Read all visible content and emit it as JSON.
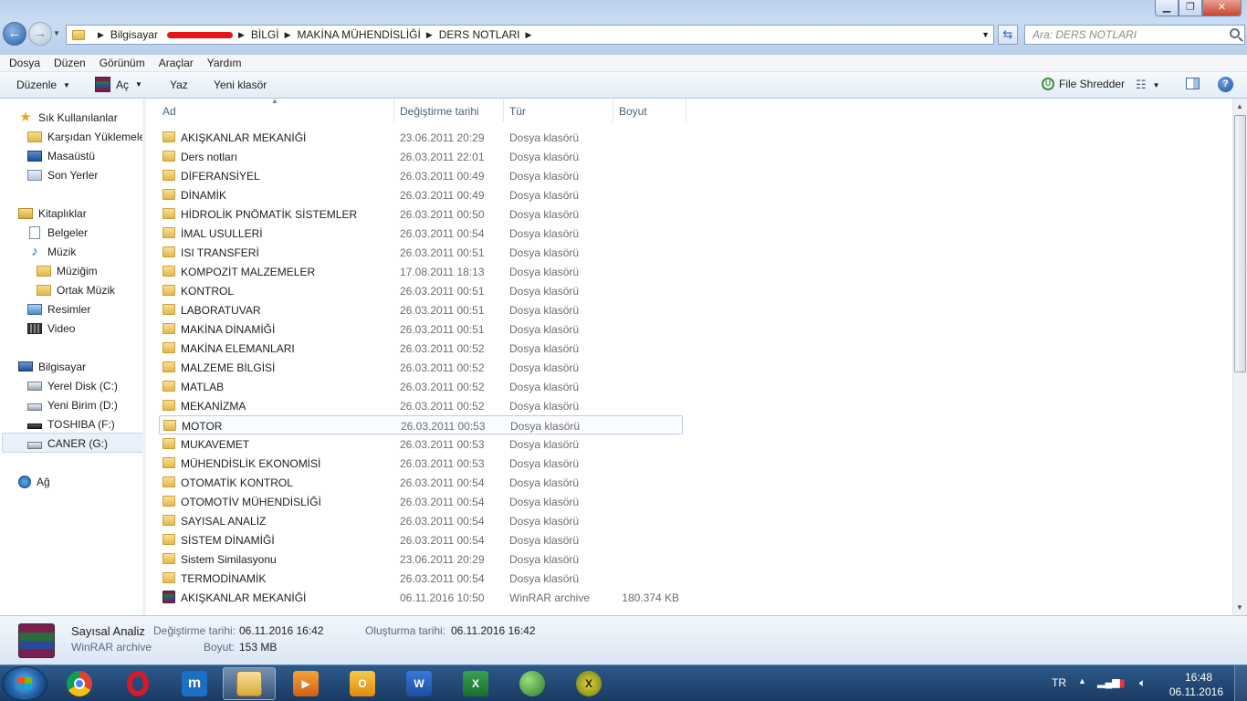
{
  "window": {
    "min_icon": "minimize-icon",
    "max_icon": "maximize-icon",
    "close_icon": "close-icon"
  },
  "address": {
    "crumbs": [
      "Bilgisayar",
      "BİLGİ",
      "MAKİNA MÜHENDİSLİĞİ",
      "DERS NOTLARI"
    ],
    "search_placeholder": "Ara: DERS NOTLARI"
  },
  "menu": [
    "Dosya",
    "Düzen",
    "Görünüm",
    "Araçlar",
    "Yardım"
  ],
  "toolbar": {
    "organize": "Düzenle",
    "open": "Aç",
    "write": "Yaz",
    "new_folder": "Yeni klasör",
    "shredder": "File Shredder"
  },
  "nav": {
    "favorites": "Sık Kullanılanlar",
    "downloads": "Karşıdan Yüklemeler",
    "desktop": "Masaüstü",
    "recent": "Son Yerler",
    "libraries": "Kitaplıklar",
    "documents": "Belgeler",
    "music": "Müzik",
    "my_music": "Müziğim",
    "public_music": "Ortak Müzik",
    "pictures": "Resimler",
    "video": "Video",
    "computer": "Bilgisayar",
    "disk_c": "Yerel Disk (C:)",
    "disk_d": "Yeni Birim (D:)",
    "disk_f": "TOSHIBA (F:)",
    "disk_g": "CANER (G:)",
    "network": "Ağ"
  },
  "columns": {
    "name": "Ad",
    "modified": "Değiştirme tarihi",
    "type": "Tür",
    "size": "Boyut"
  },
  "files": [
    {
      "name": "AKIŞKANLAR MEKANİĞİ",
      "date": "23.06.2011 20:29",
      "type": "Dosya klasörü",
      "size": "",
      "kind": "folder"
    },
    {
      "name": "Ders notları",
      "date": "26.03.2011 22:01",
      "type": "Dosya klasörü",
      "size": "",
      "kind": "folder"
    },
    {
      "name": "DİFERANSİYEL",
      "date": "26.03.2011 00:49",
      "type": "Dosya klasörü",
      "size": "",
      "kind": "folder"
    },
    {
      "name": "DİNAMİK",
      "date": "26.03.2011 00:49",
      "type": "Dosya klasörü",
      "size": "",
      "kind": "folder"
    },
    {
      "name": "HİDROLİK PNÖMATİK SİSTEMLER",
      "date": "26.03.2011 00:50",
      "type": "Dosya klasörü",
      "size": "",
      "kind": "folder"
    },
    {
      "name": "İMAL USULLERİ",
      "date": "26.03.2011 00:54",
      "type": "Dosya klasörü",
      "size": "",
      "kind": "folder"
    },
    {
      "name": "ISI TRANSFERİ",
      "date": "26.03.2011 00:51",
      "type": "Dosya klasörü",
      "size": "",
      "kind": "folder"
    },
    {
      "name": "KOMPOZİT MALZEMELER",
      "date": "17.08.2011 18:13",
      "type": "Dosya klasörü",
      "size": "",
      "kind": "folder"
    },
    {
      "name": "KONTROL",
      "date": "26.03.2011 00:51",
      "type": "Dosya klasörü",
      "size": "",
      "kind": "folder"
    },
    {
      "name": "LABORATUVAR",
      "date": "26.03.2011 00:51",
      "type": "Dosya klasörü",
      "size": "",
      "kind": "folder"
    },
    {
      "name": "MAKİNA DİNAMİĞİ",
      "date": "26.03.2011 00:51",
      "type": "Dosya klasörü",
      "size": "",
      "kind": "folder"
    },
    {
      "name": "MAKİNA ELEMANLARI",
      "date": "26.03.2011 00:52",
      "type": "Dosya klasörü",
      "size": "",
      "kind": "folder"
    },
    {
      "name": "MALZEME BİLGİSİ",
      "date": "26.03.2011 00:52",
      "type": "Dosya klasörü",
      "size": "",
      "kind": "folder"
    },
    {
      "name": "MATLAB",
      "date": "26.03.2011 00:52",
      "type": "Dosya klasörü",
      "size": "",
      "kind": "folder"
    },
    {
      "name": "MEKANİZMA",
      "date": "26.03.2011 00:52",
      "type": "Dosya klasörü",
      "size": "",
      "kind": "folder"
    },
    {
      "name": "MOTOR",
      "date": "26.03.2011 00:53",
      "type": "Dosya klasörü",
      "size": "",
      "kind": "folder"
    },
    {
      "name": "MUKAVEMET",
      "date": "26.03.2011 00:53",
      "type": "Dosya klasörü",
      "size": "",
      "kind": "folder"
    },
    {
      "name": "MÜHENDİSLİK EKONOMİSİ",
      "date": "26.03.2011 00:53",
      "type": "Dosya klasörü",
      "size": "",
      "kind": "folder"
    },
    {
      "name": "OTOMATİK KONTROL",
      "date": "26.03.2011 00:54",
      "type": "Dosya klasörü",
      "size": "",
      "kind": "folder"
    },
    {
      "name": "OTOMOTİV MÜHENDİSLİĞİ",
      "date": "26.03.2011 00:54",
      "type": "Dosya klasörü",
      "size": "",
      "kind": "folder"
    },
    {
      "name": "SAYISAL ANALİZ",
      "date": "26.03.2011 00:54",
      "type": "Dosya klasörü",
      "size": "",
      "kind": "folder"
    },
    {
      "name": "SİSTEM DİNAMİĞİ",
      "date": "26.03.2011 00:54",
      "type": "Dosya klasörü",
      "size": "",
      "kind": "folder"
    },
    {
      "name": "Sistem Similasyonu",
      "date": "23.06.2011 20:29",
      "type": "Dosya klasörü",
      "size": "",
      "kind": "folder"
    },
    {
      "name": "TERMODİNAMİK",
      "date": "26.03.2011 00:54",
      "type": "Dosya klasörü",
      "size": "",
      "kind": "folder"
    },
    {
      "name": "AKIŞKANLAR MEKANİĞİ",
      "date": "06.11.2016 10:50",
      "type": "WinRAR archive",
      "size": "180.374 KB",
      "kind": "rar"
    }
  ],
  "selected_index": 15,
  "details": {
    "name": "Sayısal Analiz",
    "type": "WinRAR archive",
    "modified_label": "Değiştirme tarihi:",
    "modified_value": "06.11.2016 16:42",
    "created_label": "Oluşturma tarihi:",
    "created_value": "06.11.2016 16:42",
    "size_label": "Boyut:",
    "size_value": "153 MB"
  },
  "taskbar": {
    "apps": [
      "chrome-icon",
      "opera-icon",
      "maxthon-icon",
      "explorer-icon",
      "media-player-icon",
      "outlook-icon",
      "word-icon",
      "excel-icon",
      "network-globe-icon",
      "game-x-icon"
    ],
    "lang": "TR",
    "time": "16:48",
    "date": "06.11.2016"
  }
}
